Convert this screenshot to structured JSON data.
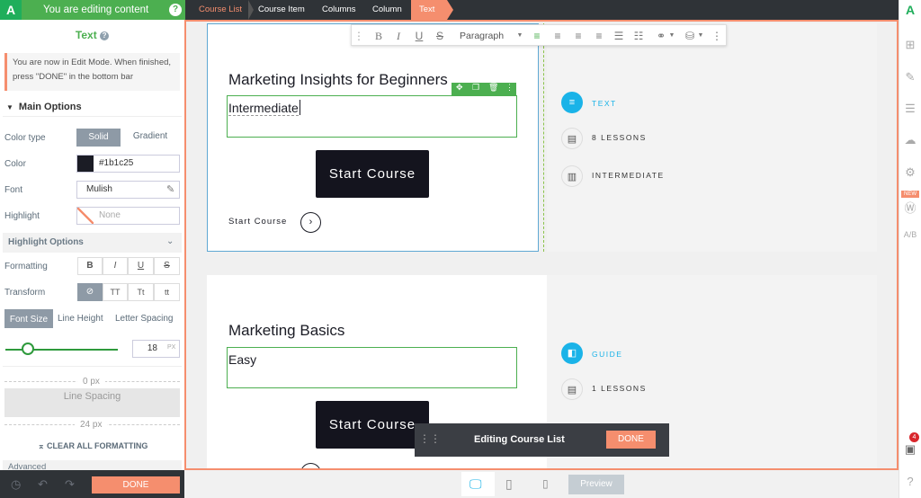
{
  "header": {
    "logo": "A",
    "editing_label": "You are editing content",
    "help_icon": "?",
    "breadcrumbs": [
      "Course List",
      "Course Item",
      "Columns",
      "Column",
      "Text"
    ]
  },
  "sidebar": {
    "title": "Text",
    "title_help": "?",
    "notice": "You are now in Edit Mode. When finished, press \"DONE\" in the bottom bar",
    "main_options": "Main Options",
    "color_type_label": "Color type",
    "color_type_solid": "Solid",
    "color_type_gradient": "Gradient",
    "color_label": "Color",
    "color_value": "#1b1c25",
    "font_label": "Font",
    "font_value": "Mulish",
    "highlight_label": "Highlight",
    "highlight_value": "None",
    "highlight_options": "Highlight Options",
    "formatting_label": "Formatting",
    "formatting_buttons": [
      "B",
      "I",
      "U",
      "S"
    ],
    "transform_label": "Transform",
    "transform_buttons": [
      "⊘",
      "TT",
      "Tt",
      "tt"
    ],
    "tabs": [
      "Font Size",
      "Line Height",
      "Letter Spacing"
    ],
    "font_size_value": "18",
    "font_size_unit": "PX",
    "slider_level": 0.15,
    "line_spacing_top": "0 px",
    "line_spacing_label": "Line Spacing",
    "line_spacing_bottom": "24 px",
    "clear_formatting": "CLEAR ALL FORMATTING",
    "advanced": "Advanced",
    "done": "DONE"
  },
  "toolbar": {
    "paragraph": "Paragraph"
  },
  "courses": [
    {
      "title": "Marketing Insights for Beginners",
      "level_text": "Intermediate",
      "button": "Start Course",
      "link": "Start Course",
      "meta": [
        {
          "icon": "text-icon",
          "label": "TEXT"
        },
        {
          "icon": "document-icon",
          "label": "8 LESSONS"
        },
        {
          "icon": "bar-chart-icon",
          "label": "INTERMEDIATE"
        }
      ]
    },
    {
      "title": "Marketing Basics",
      "level_text": "Easy",
      "button": "Start Course",
      "meta": [
        {
          "icon": "guide-icon",
          "label": "GUIDE"
        },
        {
          "icon": "document-icon",
          "label": "1 LESSONS"
        }
      ]
    }
  ],
  "editing_panel": {
    "label": "Editing Course List",
    "done": "DONE"
  },
  "bottom": {
    "preview": "Preview"
  },
  "rightbar": {
    "new_badge": "NEW",
    "notification_count": "4"
  },
  "colors": {
    "accent_green": "#4caf50",
    "accent_orange": "#f58e6e",
    "topbar": "#2f3337",
    "text_dark": "#1b1c25",
    "blue": "#1ab3e8"
  }
}
